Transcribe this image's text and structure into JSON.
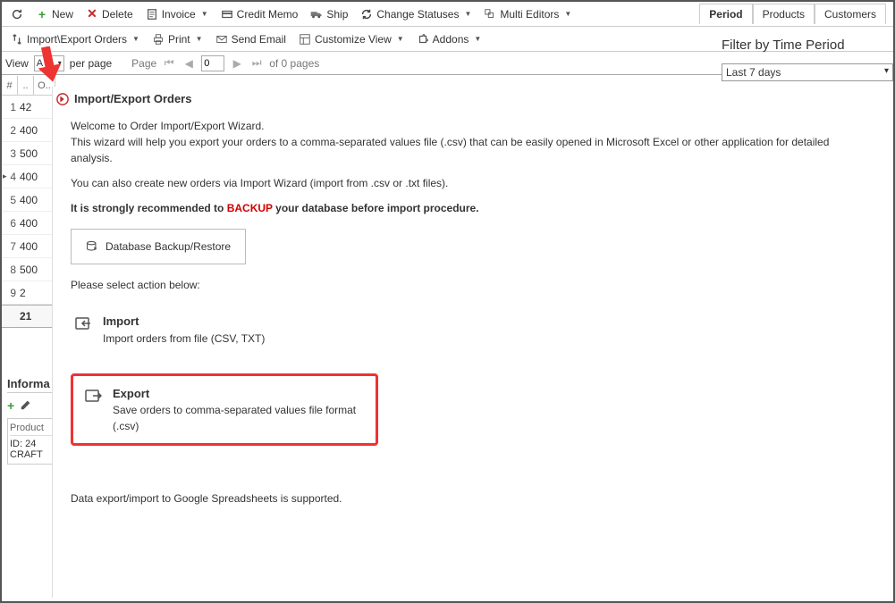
{
  "toolbar1": {
    "new": "New",
    "delete": "Delete",
    "invoice": "Invoice",
    "credit_memo": "Credit Memo",
    "ship": "Ship",
    "change_statuses": "Change Statuses",
    "multi_editors": "Multi Editors"
  },
  "toolbar2": {
    "import_export": "Import\\Export Orders",
    "print": "Print",
    "send_email": "Send Email",
    "customize_view": "Customize View",
    "addons": "Addons"
  },
  "pager": {
    "view": "View",
    "per_page": "per page",
    "page": "Page",
    "input": "0",
    "of": "of 0 pages"
  },
  "tabs": {
    "period": "Period",
    "products": "Products",
    "customers": "Customers"
  },
  "filter": {
    "title": "Filter by Time Period",
    "value": "Last 7 days"
  },
  "grid": {
    "header": [
      "#",
      "..",
      "O.."
    ],
    "rows": [
      {
        "n": "1",
        "v": "42"
      },
      {
        "n": "2",
        "v": "400"
      },
      {
        "n": "3",
        "v": "500"
      },
      {
        "n": "4",
        "v": "400"
      },
      {
        "n": "5",
        "v": "400"
      },
      {
        "n": "6",
        "v": "400"
      },
      {
        "n": "7",
        "v": "400"
      },
      {
        "n": "8",
        "v": "500"
      },
      {
        "n": "9",
        "v": "2"
      }
    ],
    "sum": "21"
  },
  "info": {
    "title": "Informa",
    "product_label": "Product",
    "id_line": "ID: 24",
    "craft_line": "CRAFT"
  },
  "modal": {
    "title": "Import/Export Orders",
    "welcome": "Welcome to Order Import/Export Wizard.",
    "desc1": "This wizard will help you export your orders to a comma-separated values file (.csv) that can be easily opened in Microsoft Excel or other application for detailed analysis.",
    "desc2": "You can also create new orders via Import Wizard (import from .csv or .txt files).",
    "rec_pre": "It is strongly recommended to ",
    "rec_mid": "BACKUP",
    "rec_post": " your database before import procedure.",
    "db_button": "Database Backup/Restore",
    "select_label": "Please select action below:",
    "import_title": "Import",
    "import_desc": "Import orders from file (CSV, TXT)",
    "export_title": "Export",
    "export_desc": "Save orders to comma-separated values file format (.csv)",
    "gs_note": "Data export/import to Google Spreadsheets is supported."
  }
}
